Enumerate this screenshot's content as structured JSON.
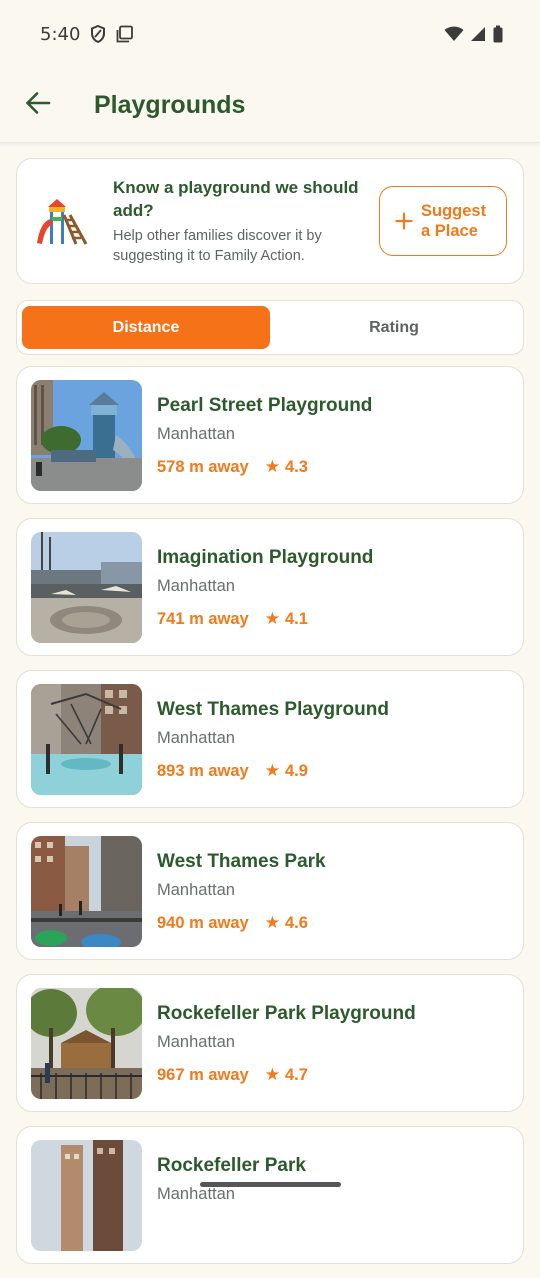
{
  "status_bar": {
    "time": "5:40",
    "icons": [
      "shield-icon",
      "screenshot-icon",
      "wifi-icon",
      "signal-icon",
      "battery-icon"
    ]
  },
  "app_bar": {
    "title": "Playgrounds",
    "back_icon": "arrow-back-icon"
  },
  "suggest": {
    "heading": "Know a playground we should add?",
    "description": "Help other families discover it by suggesting it to Family Action.",
    "button_icon": "plus-icon",
    "button_label": "Suggest a Place"
  },
  "sort_tabs": [
    {
      "label": "Distance",
      "selected": true
    },
    {
      "label": "Rating",
      "selected": false
    }
  ],
  "playgrounds": [
    {
      "name": "Pearl Street Playground",
      "area": "Manhattan",
      "distance": "578 m away",
      "rating": "4.3"
    },
    {
      "name": "Imagination Playground",
      "area": "Manhattan",
      "distance": "741 m away",
      "rating": "4.1"
    },
    {
      "name": "West Thames Playground",
      "area": "Manhattan",
      "distance": "893 m away",
      "rating": "4.9"
    },
    {
      "name": "West Thames Park",
      "area": "Manhattan",
      "distance": "940 m away",
      "rating": "4.6"
    },
    {
      "name": "Rockefeller Park Playground",
      "area": "Manhattan",
      "distance": "967 m away",
      "rating": "4.7"
    },
    {
      "name": "Rockefeller Park",
      "area": "Manhattan",
      "distance": "",
      "rating": ""
    }
  ],
  "colors": {
    "brand_green": "#2d5a2d",
    "accent_orange": "#f57218",
    "background": "#faf8ef"
  }
}
